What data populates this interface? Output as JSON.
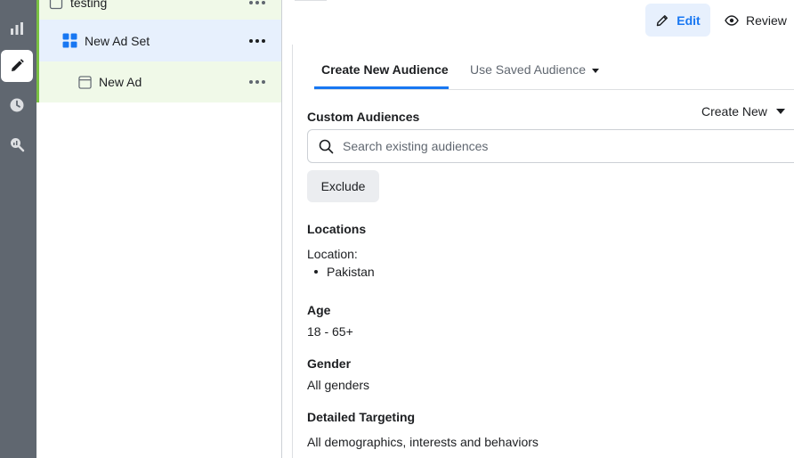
{
  "rail": {
    "items": [
      {
        "icon": "chart-icon"
      },
      {
        "icon": "pencil-icon",
        "active": true
      },
      {
        "icon": "clock-icon"
      },
      {
        "icon": "magnify-chart-icon"
      }
    ]
  },
  "tree": {
    "campaign": {
      "label": "testing"
    },
    "adset": {
      "label": "New Ad Set"
    },
    "ad": {
      "label": "New Ad"
    }
  },
  "header": {
    "edit_label": "Edit",
    "review_label": "Review"
  },
  "tabs": [
    {
      "label": "Create New Audience",
      "active": true
    },
    {
      "label": "Use Saved Audience",
      "active": false
    }
  ],
  "custom_audiences": {
    "title": "Custom Audiences",
    "create_new_label": "Create New",
    "search_placeholder": "Search existing audiences",
    "exclude_label": "Exclude"
  },
  "locations": {
    "title": "Locations",
    "location_label": "Location:",
    "items": [
      "Pakistan"
    ]
  },
  "age": {
    "title": "Age",
    "value": "18 - 65+"
  },
  "gender": {
    "title": "Gender",
    "value": "All genders"
  },
  "detailed_targeting": {
    "title": "Detailed Targeting",
    "value": "All demographics, interests and behaviors"
  },
  "colors": {
    "accent": "#1877f2",
    "rail": "#606770",
    "tree_green": "#f0f9e8",
    "tree_blue": "#e7f0fd"
  }
}
